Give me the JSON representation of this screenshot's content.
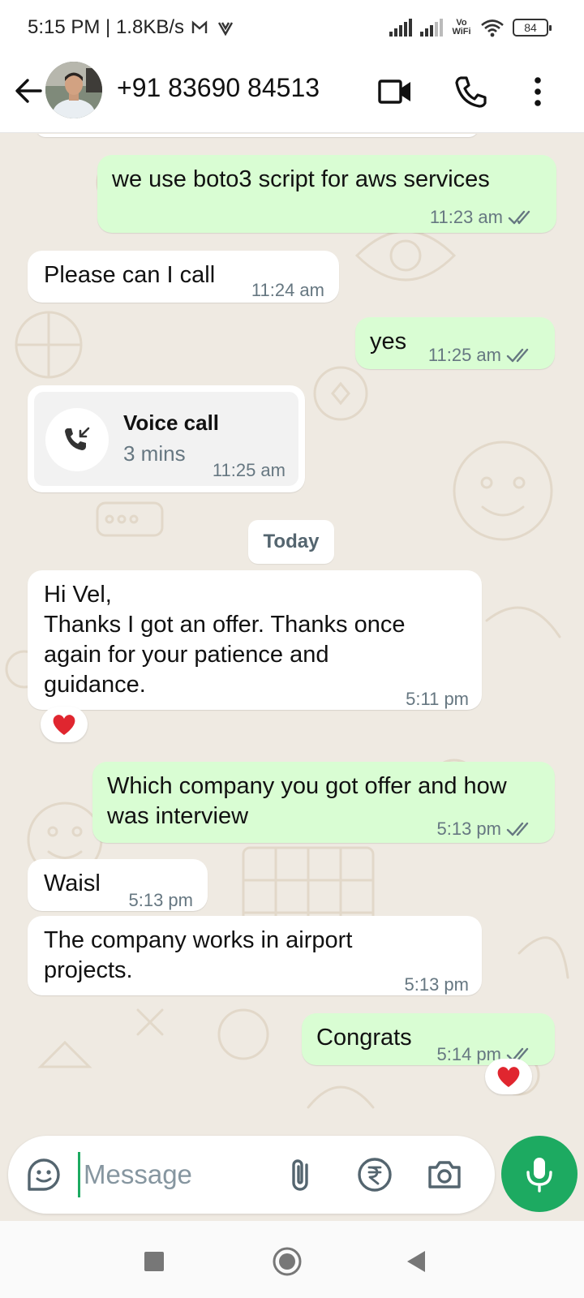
{
  "status_bar": {
    "time": "5:15 PM | 1.8KB/s",
    "network_label": "Vo WiFi",
    "battery": "84"
  },
  "header": {
    "contact": "+91 83690 84513"
  },
  "messages": [
    {
      "dir": "out",
      "text": "we use boto3 script for aws services",
      "time": "11:23 am"
    },
    {
      "dir": "in",
      "text": "Please can I call",
      "time": "11:24 am"
    },
    {
      "dir": "out",
      "text": "yes",
      "time": "11:25 am"
    },
    {
      "dir": "in",
      "type": "call",
      "title": "Voice call",
      "duration": "3 mins",
      "time": "11:25 am"
    },
    {
      "dir": "in",
      "text": "Hi Vel,\nThanks I got an offer. Thanks once again for your patience and guidance.",
      "time": "5:11 pm",
      "reaction": "heart"
    },
    {
      "dir": "out",
      "text": "Which company you got offer and how was interview",
      "time": "5:13 pm"
    },
    {
      "dir": "in",
      "text": "Waisl",
      "time": "5:13 pm"
    },
    {
      "dir": "in",
      "text": "The company works in airport projects.",
      "time": "5:13 pm"
    },
    {
      "dir": "out",
      "text": "Congrats",
      "time": "5:14 pm",
      "reaction": "heart"
    }
  ],
  "date_divider": "Today",
  "input": {
    "placeholder": "Message"
  },
  "colors": {
    "outgoing_bubble": "#d9fdd3",
    "incoming_bubble": "#ffffff",
    "accent": "#1daa61",
    "tick": "#667781"
  }
}
